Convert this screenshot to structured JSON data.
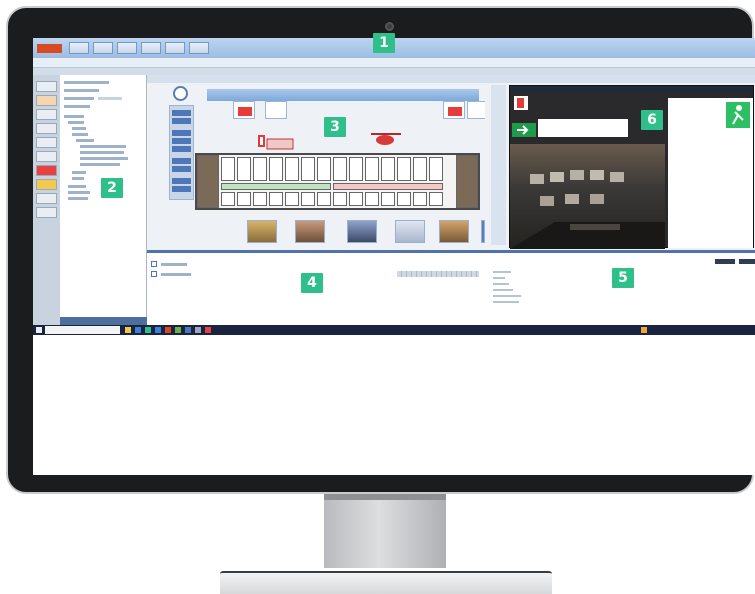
{
  "markers": [
    "1",
    "2",
    "3",
    "4",
    "5",
    "6"
  ],
  "colors": {
    "marker": "#2fbf8a",
    "bezel": "#1b1c1e",
    "titlebar": "#9cbde2",
    "taskbar": "#1a2440",
    "alarm": "#e63c3c",
    "exit_green": "#1f9b4c"
  },
  "icons": [
    "camera-icon",
    "clock-icon",
    "exit-sign-icon",
    "start-icon",
    "search-icon"
  ]
}
